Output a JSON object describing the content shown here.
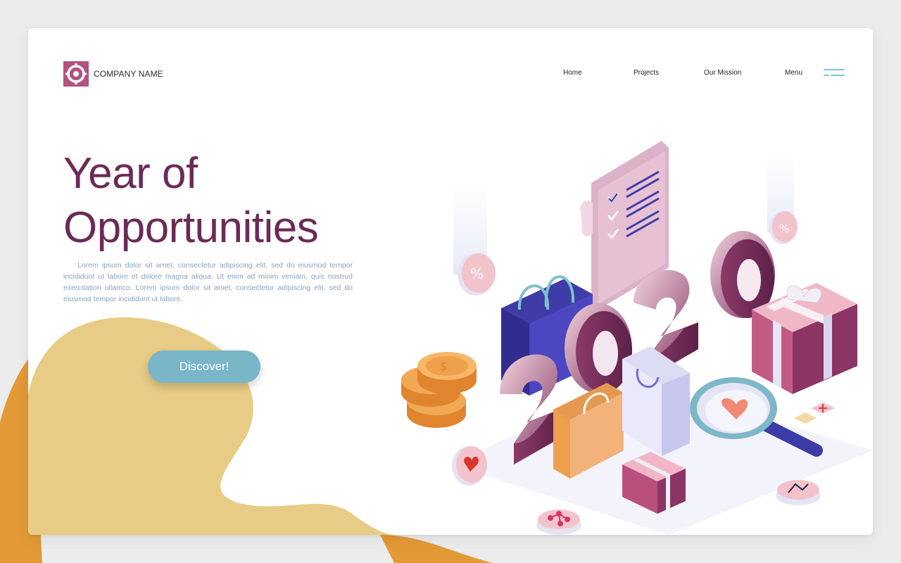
{
  "colors": {
    "accent_plum": "#6b2b55",
    "logo_pink": "#b2527f",
    "button_teal": "#78b6c8",
    "blob_orange": "#e39a36",
    "blob_sand": "#e8cc85",
    "body_text": "#8aa2bd",
    "menu_lines": "#84c3d6"
  },
  "brand": {
    "name": "COMPANY NAME",
    "logo_icon": "target-icon"
  },
  "nav": {
    "items": [
      {
        "label": "Home"
      },
      {
        "label": "Projects"
      },
      {
        "label": "Our Mission"
      },
      {
        "label": "Menu"
      }
    ],
    "menu_icon": "hamburger-icon"
  },
  "hero": {
    "title_line1": "Year of",
    "title_line2": "Opportunities",
    "body": "Lorem ipsum dolor sit amet, consectetur adipiscing elit, sed do eiusmod tempor incididunt ut labore et dolore magna aliqua. Ut enim ad minim veniam, quis nostrud exercitation ullamco. Lorem ipsum dolor sit amet, consectetur adipiscing elit, sed do eiusmod tempor incididunt ut labore.",
    "cta_label": "Discover!"
  },
  "illustration": {
    "year_text": "2020",
    "icons": [
      "receipt-checklist-icon",
      "shopping-bag-icon",
      "gift-box-icon",
      "coins-icon",
      "magnifier-icon",
      "percent-badge-icon",
      "heart-badge-icon",
      "share-badge-icon",
      "chart-badge-icon",
      "tag-icon"
    ]
  }
}
